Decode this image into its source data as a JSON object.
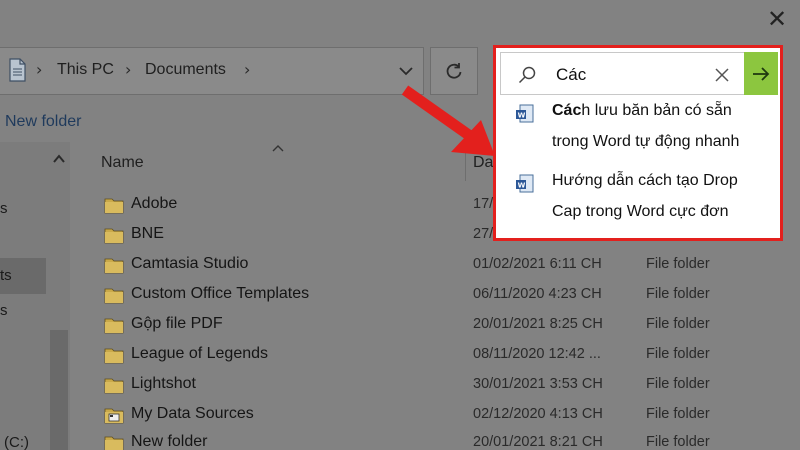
{
  "window": {
    "close_glyph": "✕"
  },
  "address_bar": {
    "crumbs": [
      "This PC",
      "Documents"
    ],
    "separator": "›"
  },
  "toolbar": {
    "new_folder_label": "New folder"
  },
  "nav_pane": {
    "fragments": [
      "s",
      "ts",
      "s",
      "(C:)"
    ]
  },
  "columns": {
    "name": "Name",
    "date": "Da"
  },
  "files": [
    {
      "name": "Adobe",
      "date": "17/",
      "type": "",
      "icon": "folder-icon"
    },
    {
      "name": "BNE",
      "date": "27/",
      "type": "",
      "icon": "folder-icon"
    },
    {
      "name": "Camtasia Studio",
      "date": "01/02/2021 6:11 CH",
      "type": "File folder",
      "icon": "folder-icon"
    },
    {
      "name": "Custom Office Templates",
      "date": "06/11/2020 4:23 CH",
      "type": "File folder",
      "icon": "folder-icon"
    },
    {
      "name": "Gộp file PDF",
      "date": "20/01/2021 8:25 CH",
      "type": "File folder",
      "icon": "folder-icon"
    },
    {
      "name": "League of Legends",
      "date": "08/11/2020 12:42 ...",
      "type": "File folder",
      "icon": "folder-icon"
    },
    {
      "name": "Lightshot",
      "date": "30/01/2021 3:53 CH",
      "type": "File folder",
      "icon": "folder-icon"
    },
    {
      "name": "My Data Sources",
      "date": "02/12/2020 4:13 CH",
      "type": "File folder",
      "icon": "data-sources-icon"
    },
    {
      "name": "New folder",
      "date": "20/01/2021 8:21 CH",
      "type": "File folder",
      "icon": "folder-icon"
    }
  ],
  "search": {
    "query": "Các",
    "suggestions": [
      {
        "line1": "Cách lưu bản bản có sẵn",
        "line1_bold": "Các",
        "line1_rest": "h lưu băn bản có sẵn",
        "line2": "trong Word tự động nhanh"
      },
      {
        "line1_bold": "",
        "line1_rest": "Hướng dẫn cách tạo Drop",
        "line2": "Cap trong Word cực đơn"
      }
    ]
  },
  "colors": {
    "highlight_border": "#e3201d",
    "go_button": "#8cc63f",
    "arrow": "#e3201d",
    "overlay_bg": "#828282"
  }
}
